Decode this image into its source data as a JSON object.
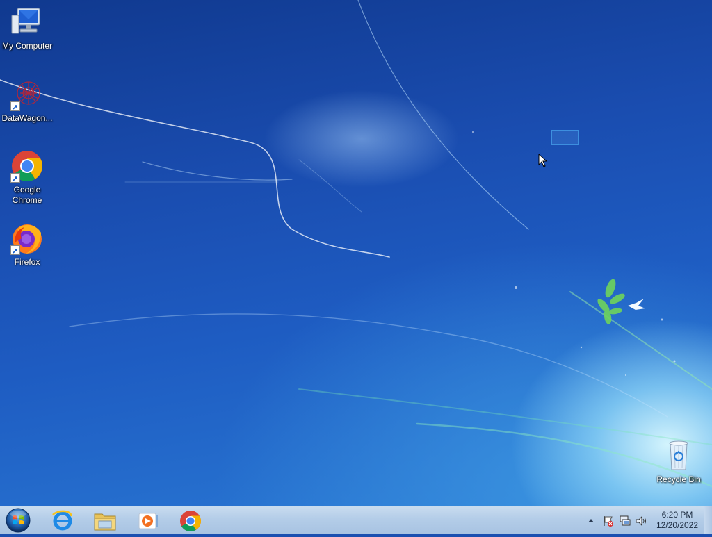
{
  "desktop": {
    "icons": [
      {
        "label": "My Computer",
        "icon": "computer-icon"
      },
      {
        "label": "DataWagon...",
        "icon": "datawagon-icon"
      },
      {
        "label": "Google Chrome",
        "icon": "chrome-icon"
      },
      {
        "label": "Firefox",
        "icon": "firefox-icon"
      },
      {
        "label": "Recycle Bin",
        "icon": "recycle-bin-icon"
      }
    ]
  },
  "taskbar": {
    "pinned": [
      {
        "icon": "internet-explorer-icon"
      },
      {
        "icon": "file-explorer-icon"
      },
      {
        "icon": "media-player-icon"
      },
      {
        "icon": "chrome-icon"
      }
    ],
    "tray": {
      "icons": [
        "show-hidden-icons-arrow",
        "action-center-flag-icon",
        "network-icon",
        "volume-icon"
      ]
    },
    "clock": {
      "time": "6:20 PM",
      "date": "12/20/2022"
    }
  }
}
